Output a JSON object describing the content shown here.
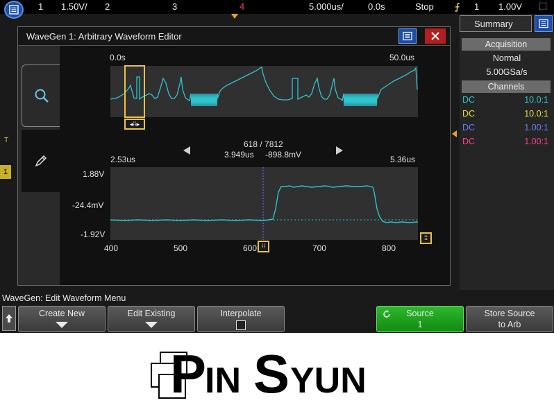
{
  "topbar": {
    "ch1_label": "1",
    "ch1_scale": "1.50V/",
    "ch2_label": "2",
    "ch3_label": "3",
    "ch4_label": "4",
    "timebase": "5.000us/",
    "delay": "0.0s",
    "run_state": "Stop",
    "trigger_source": "1",
    "trigger_level": "1.00V"
  },
  "editor": {
    "title": "WaveGen 1: Arbitrary Waveform Editor",
    "overview": {
      "start_time": "0.0s",
      "end_time": "50.0us"
    },
    "nav": {
      "point_readout": "618 / 7812",
      "time_readout": "3.949us",
      "voltage_readout": "-898.8mV"
    },
    "detail": {
      "start_time": "2.53us",
      "end_time": "5.36us",
      "y_top": "1.88V",
      "y_mid": "-24.4mV",
      "y_bottom": "-1.92V",
      "x_ticks": [
        "400",
        "500",
        "600",
        "700",
        "800"
      ]
    }
  },
  "summary": {
    "tab_label": "Summary",
    "acquisition_header": "Acquisition",
    "acq_mode": "Normal",
    "sample_rate": "5.00GSa/s",
    "channels_header": "Channels",
    "channels": [
      {
        "coupling": "DC",
        "probe": "10.0:1",
        "color": "#2ec4d0"
      },
      {
        "coupling": "DC",
        "probe": "10.0:1",
        "color": "#e0e040"
      },
      {
        "coupling": "DC",
        "probe": "1.00:1",
        "color": "#6a7cff"
      },
      {
        "coupling": "DC",
        "probe": "1.00:1",
        "color": "#ff3c8c"
      }
    ]
  },
  "softkeys": {
    "menu_title": "WaveGen: Edit Waveform Menu",
    "create_new": "Create New",
    "edit_existing": "Edit Existing",
    "interpolate": "Interpolate",
    "source_label": "Source",
    "source_value": "1",
    "store_line1": "Store Source",
    "store_line2": "to Arb"
  },
  "logo": {
    "text": "PINSYUN"
  },
  "colors": {
    "trace": "#2ec4d0",
    "cursor": "#7b6cff",
    "marker": "#e8c24a",
    "accent_blue": "#1d4fa8",
    "close_red": "#b41e1e",
    "source_green": "#1aa01a"
  },
  "icons": [
    "menu-icon",
    "search-icon",
    "pencil-icon",
    "close-icon",
    "left-arrow-icon",
    "right-arrow-icon",
    "up-arrow-icon",
    "trigger-icon"
  ]
}
